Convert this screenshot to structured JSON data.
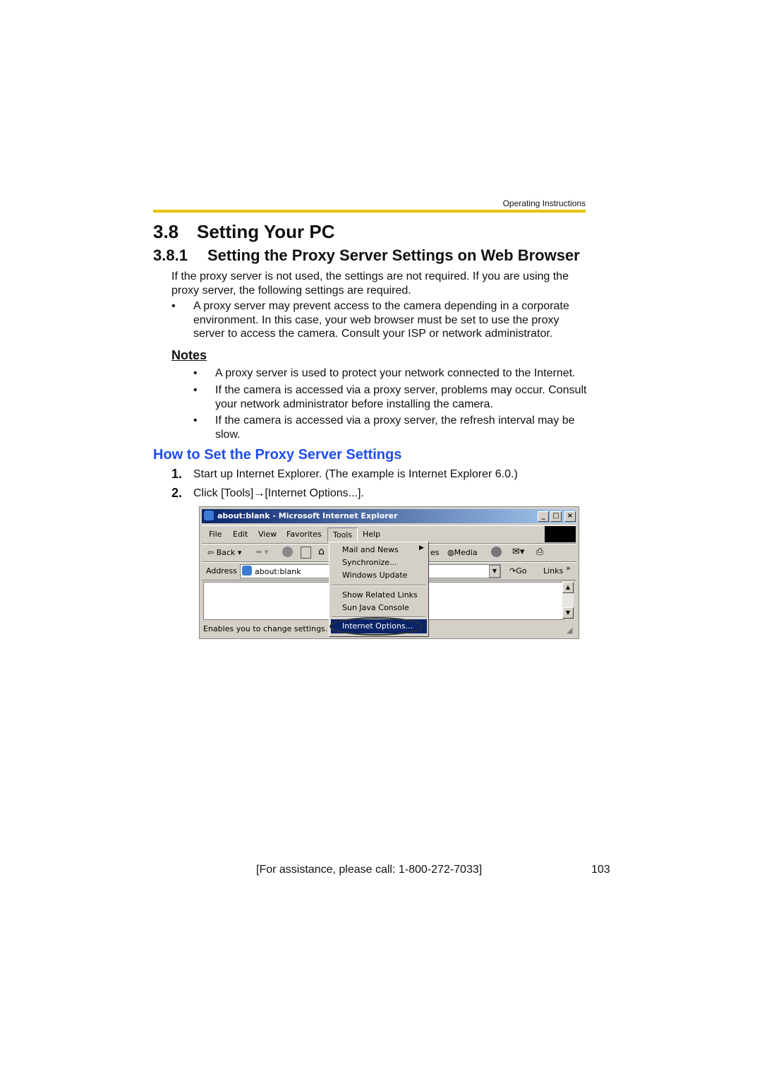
{
  "header": {
    "running_title": "Operating Instructions",
    "rule_color": "#e6c200"
  },
  "section": {
    "number": "3.8",
    "title": "Setting Your PC"
  },
  "subsection": {
    "number": "3.8.1",
    "title": "Setting the Proxy Server Settings on Web Browser"
  },
  "intro": [
    "If the proxy server is not used, the settings are not required. If you are using the",
    "proxy server, the following settings are required."
  ],
  "bullet": {
    "symbol": "•",
    "lines": [
      "A proxy server may prevent access to the camera depending in a corporate",
      "environment. In this case, your web browser must be set to use the proxy",
      "server to access the camera. Consult your ISP or network administrator."
    ]
  },
  "notes": {
    "heading": "Notes",
    "items": [
      {
        "lines": [
          "A proxy server is used to protect your network connected to the Internet."
        ]
      },
      {
        "lines": [
          "If the camera is accessed via a proxy server, problems may occur. Consult",
          "your network administrator before installing the camera."
        ]
      },
      {
        "lines": [
          "If the camera is accessed via a proxy server, the refresh interval may be",
          "slow."
        ]
      }
    ]
  },
  "howto": {
    "heading": "How to Set the Proxy Server Settings",
    "color": "#1f4df2",
    "steps": [
      {
        "num": "1.",
        "text": "Start up Internet Explorer. (The example is Internet Explorer 6.0.)"
      },
      {
        "num": "2.",
        "text": "Click [Tools]→[Internet Options...]."
      }
    ]
  },
  "screenshot": {
    "title": "about:blank - Microsoft Internet Explorer",
    "menus": [
      "File",
      "Edit",
      "View",
      "Favorites",
      "Tools",
      "Help"
    ],
    "toolbar": {
      "back": "Back",
      "media_partial": "es",
      "media": "Media"
    },
    "address": {
      "label": "Address",
      "value": "about:blank",
      "go": "Go",
      "links": "Links",
      "more": "»"
    },
    "tools_menu": [
      "Mail and News",
      "Synchronize...",
      "Windows Update",
      "Show Related Links",
      "Sun Java Console",
      "Internet Options..."
    ],
    "status": "Enables you to change settings."
  },
  "footer": {
    "assistance": "[For assistance, please call: 1-800-272-7033]",
    "page_number": "103"
  }
}
